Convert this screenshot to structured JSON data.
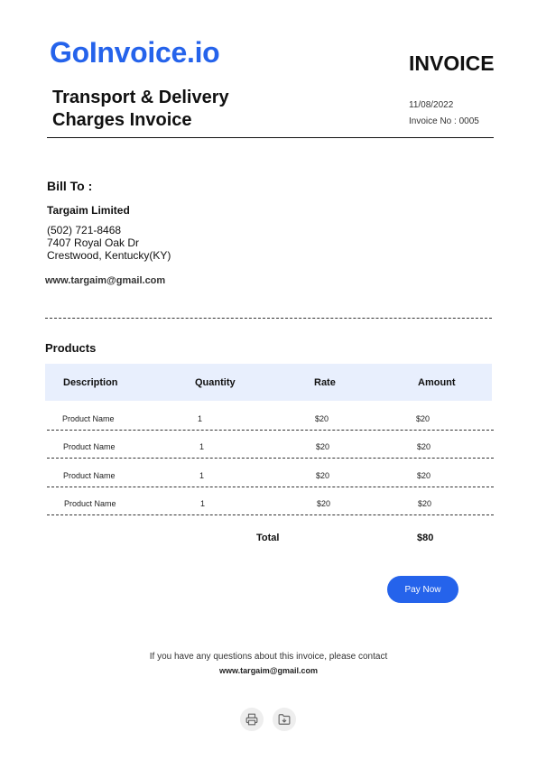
{
  "header": {
    "brand": "GoInvoice.io",
    "doc_type": "INVOICE",
    "title": "Transport & Delivery Charges Invoice",
    "date": "11/08/2022",
    "invoice_no": "Invoice No : 0005"
  },
  "bill_to": {
    "heading": "Bill To :",
    "name": "Targaim Limited",
    "phone": "(502) 721-8468",
    "street": "7407 Royal Oak Dr",
    "city": "Crestwood, Kentucky(KY)",
    "email": "www.targaim@gmail.com"
  },
  "products": {
    "heading": "Products",
    "columns": [
      "Description",
      "Quantity",
      "Rate",
      "Amount"
    ],
    "rows": [
      [
        "Product  Name",
        "1",
        "$20",
        "$20"
      ],
      [
        "Product  Name",
        "1",
        "$20",
        "$20"
      ],
      [
        "Product  Name",
        "1",
        "$20",
        "$20"
      ],
      [
        "Product  Name",
        "1",
        "$20",
        "$20"
      ]
    ],
    "total_label": "Total",
    "total_value": "$80"
  },
  "actions": {
    "pay_label": "Pay Now"
  },
  "footer": {
    "text": "If you have any questions about this invoice, please contact",
    "email": "www.targaim@gmail.com"
  },
  "icons": [
    "printer-icon",
    "download-icon"
  ],
  "colors": {
    "brand": "#2563eb",
    "table_header_bg": "#e8effd"
  }
}
